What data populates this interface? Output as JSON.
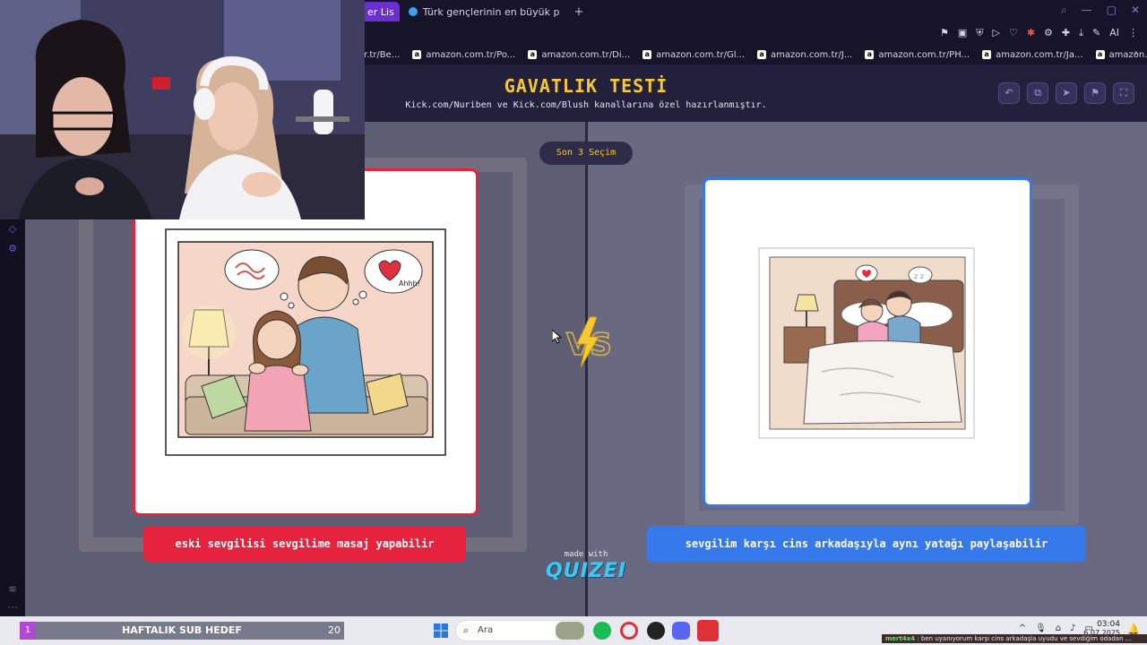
{
  "browser": {
    "tabs": [
      {
        "label": "er Lis"
      },
      {
        "label": "Türk gençlerinin en büyük p"
      }
    ],
    "new_tab": "+",
    "bookmarks": [
      {
        "label": "r.tr/Be..."
      },
      {
        "label": "amazon.com.tr/Po..."
      },
      {
        "label": "amazon.com.tr/Di..."
      },
      {
        "label": "amazon.com.tr/Gl..."
      },
      {
        "label": "amazon.com.tr/J..."
      },
      {
        "label": "amazon.com.tr/PH..."
      },
      {
        "label": "amazon.com.tr/Ja..."
      },
      {
        "label": "amazon.com.tr/TY..."
      }
    ],
    "ai_label": "AI"
  },
  "quiz": {
    "title": "GAVATLIK TESTİ",
    "subtitle": "Kick.com/Nuriben ve Kick.com/Blush kanallarına özel hazırlanmıştır.",
    "round": "Son 3 Seçim",
    "left_option": "eski sevgilisi sevgilime masaj yapabilir",
    "right_option": "sevgilim karşı cins arkadaşıyla aynı yatağı paylaşabilir",
    "vs": "VS",
    "made_with": "made with",
    "brand": "QUIZEI",
    "speech_bubble": "Ahhh!"
  },
  "overlay": {
    "sub_goal_title": "HAFTALIK SUB HEDEF",
    "sub_goal_current": "1",
    "sub_goal_target": "20"
  },
  "taskbar": {
    "search_placeholder": "Ara",
    "time": "03:04",
    "date": "6.07.2025",
    "ticker_user": "mert4x4",
    "ticker_text": ": ben uyanıyorum karşı cins arkadaşla uyudu ve sevdiğim odadan ..."
  },
  "colors": {
    "accent_left": "#e5233f",
    "accent_right": "#3579ea",
    "title_yellow": "#f5c935",
    "tab_active": "#6a2fd0"
  }
}
